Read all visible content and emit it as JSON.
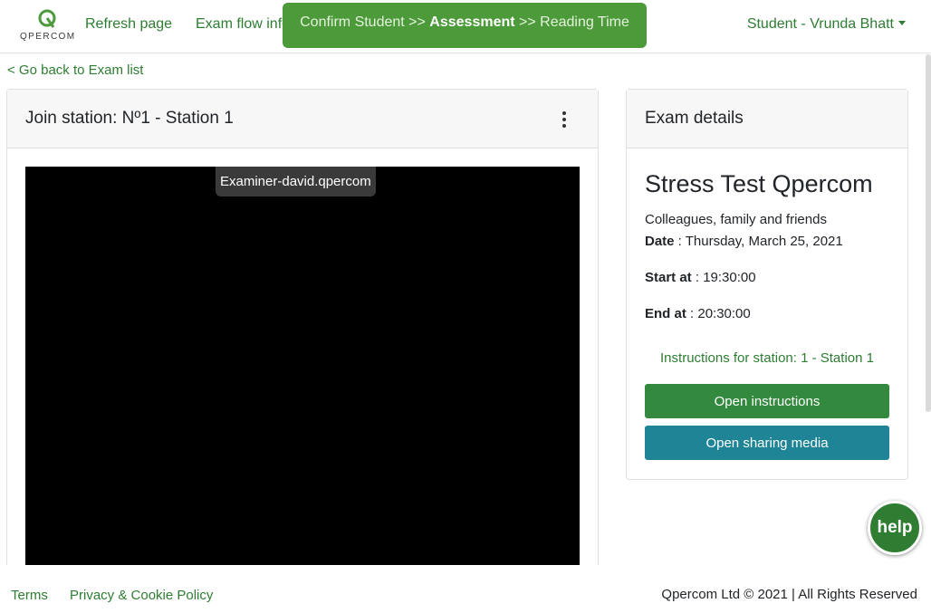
{
  "nav": {
    "logo_text": "QPERCOM",
    "refresh_label": "Refresh page",
    "exam_flow_label": "Exam flow info",
    "stage": {
      "before": "Confirm Student >> ",
      "current": "Assessment",
      "after": " >> Reading Time"
    },
    "user_label": "Student - Vrunda Bhatt"
  },
  "back_link": "< Go back to Exam list",
  "station": {
    "title": "Join station: Nº1 - Station 1",
    "video_label": "Examiner-david.qpercom"
  },
  "exam": {
    "header": "Exam details",
    "name": "Stress Test Qpercom",
    "audience": "Colleagues, family and friends",
    "date_label": "Date",
    "date_value": " : Thursday, March 25, 2021",
    "start_label": "Start at",
    "start_value": " : 19:30:00",
    "end_label": "End at",
    "end_value": " : 20:30:00",
    "instructions_label": "Instructions for station: 1 - Station 1",
    "open_instructions": "Open instructions",
    "open_sharing": "Open sharing media"
  },
  "help_label": "help",
  "footer": {
    "terms": "Terms",
    "privacy": "Privacy & Cookie Policy",
    "copyright": "Qpercom Ltd © 2021 | All Rights Reserved"
  },
  "colors": {
    "brand_green": "#2e7d32",
    "banner_green": "#4d9a3a",
    "teal": "#1e8496"
  }
}
